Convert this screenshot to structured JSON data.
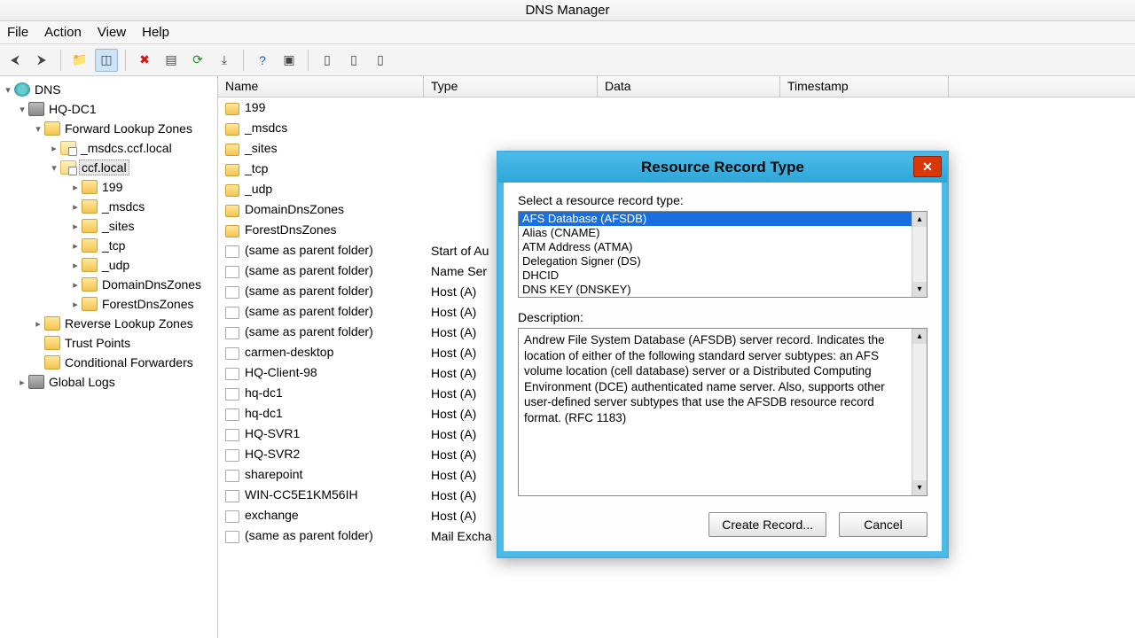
{
  "window": {
    "title": "DNS Manager"
  },
  "menu": {
    "file": "File",
    "action": "Action",
    "view": "View",
    "help": "Help"
  },
  "tree": {
    "root": "DNS",
    "server": "HQ-DC1",
    "flz": "Forward Lookup Zones",
    "z_msdcs_ccf": "_msdcs.ccf.local",
    "z_ccf": "ccf.local",
    "s_199": "199",
    "s_msdcs": "_msdcs",
    "s_sites": "_sites",
    "s_tcp": "_tcp",
    "s_udp": "_udp",
    "s_ddz": "DomainDnsZones",
    "s_fdz": "ForestDnsZones",
    "rlz": "Reverse Lookup Zones",
    "tp": "Trust Points",
    "cf": "Conditional Forwarders",
    "gl": "Global Logs"
  },
  "columns": {
    "name": "Name",
    "type": "Type",
    "data": "Data",
    "ts": "Timestamp"
  },
  "rows": [
    {
      "name": "199",
      "type": "",
      "icon": "fold"
    },
    {
      "name": "_msdcs",
      "type": "",
      "icon": "fold"
    },
    {
      "name": "_sites",
      "type": "",
      "icon": "fold"
    },
    {
      "name": "_tcp",
      "type": "",
      "icon": "fold"
    },
    {
      "name": "_udp",
      "type": "",
      "icon": "fold"
    },
    {
      "name": "DomainDnsZones",
      "type": "",
      "icon": "fold"
    },
    {
      "name": "ForestDnsZones",
      "type": "",
      "icon": "fold"
    },
    {
      "name": "(same as parent folder)",
      "type": "Start of Au",
      "icon": "rec"
    },
    {
      "name": "(same as parent folder)",
      "type": "Name Ser",
      "icon": "rec"
    },
    {
      "name": "(same as parent folder)",
      "type": "Host (A)",
      "icon": "rec"
    },
    {
      "name": "(same as parent folder)",
      "type": "Host (A)",
      "icon": "rec"
    },
    {
      "name": "(same as parent folder)",
      "type": "Host (A)",
      "icon": "rec"
    },
    {
      "name": "carmen-desktop",
      "type": "Host (A)",
      "icon": "rec"
    },
    {
      "name": "HQ-Client-98",
      "type": "Host (A)",
      "icon": "rec"
    },
    {
      "name": "hq-dc1",
      "type": "Host (A)",
      "icon": "rec"
    },
    {
      "name": "hq-dc1",
      "type": "Host (A)",
      "icon": "rec"
    },
    {
      "name": "HQ-SVR1",
      "type": "Host (A)",
      "icon": "rec"
    },
    {
      "name": "HQ-SVR2",
      "type": "Host (A)",
      "icon": "rec"
    },
    {
      "name": "sharepoint",
      "type": "Host (A)",
      "icon": "rec"
    },
    {
      "name": "WIN-CC5E1KM56IH",
      "type": "Host (A)",
      "icon": "rec"
    },
    {
      "name": "exchange",
      "type": "Host (A)",
      "icon": "rec"
    },
    {
      "name": "(same as parent folder)",
      "type": "Mail Excha",
      "icon": "rec"
    }
  ],
  "dialog": {
    "title": "Resource Record Type",
    "select_label": "Select a resource record type:",
    "items": [
      "AFS Database (AFSDB)",
      "Alias (CNAME)",
      "ATM Address (ATMA)",
      "Delegation Signer (DS)",
      "DHCID",
      "DNS KEY (DNSKEY)"
    ],
    "selected_index": 0,
    "desc_label": "Description:",
    "description": "Andrew File System Database (AFSDB) server record. Indicates the location of either of the following standard server subtypes: an AFS volume location (cell database) server or a Distributed Computing Environment (DCE) authenticated name server. Also, supports other user-defined server subtypes that use the AFSDB resource record format. (RFC 1183)",
    "create": "Create Record...",
    "cancel": "Cancel"
  }
}
